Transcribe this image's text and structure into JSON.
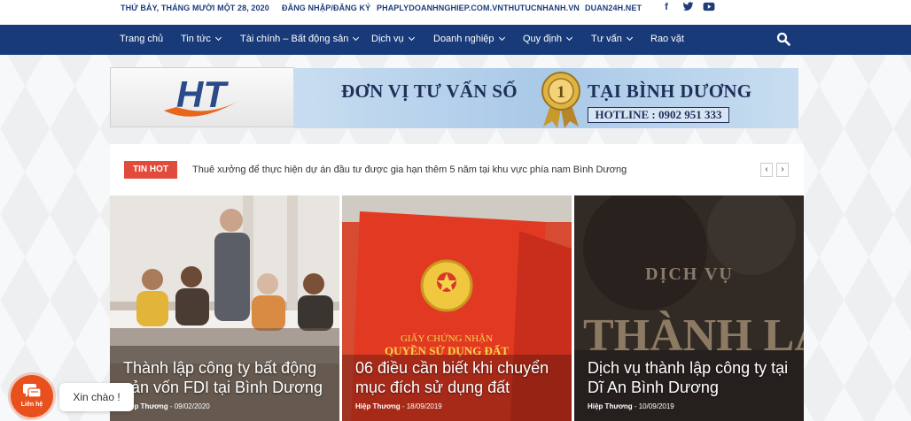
{
  "topbar": {
    "date": "THỨ BẢY, THÁNG MƯỜI MỘT 28, 2020",
    "login": "ĐĂNG NHẬP/ĐĂNG KÝ",
    "links": [
      "PHAPLYDOANHNGHIEP.COM.VN",
      "THUTUCNHANH.VN",
      "DUAN24H.NET"
    ],
    "social": [
      "facebook-icon",
      "twitter-icon",
      "youtube-icon"
    ]
  },
  "nav": {
    "items": [
      {
        "label": "Trang chủ",
        "dropdown": false
      },
      {
        "label": "Tin tức",
        "dropdown": true
      },
      {
        "label": "Tài chính – Bất động sản",
        "dropdown": true
      },
      {
        "label": "Dịch vụ",
        "dropdown": true
      },
      {
        "label": "Doanh nghiệp",
        "dropdown": true
      },
      {
        "label": "Quy định",
        "dropdown": true
      },
      {
        "label": "Tư vấn",
        "dropdown": true
      },
      {
        "label": "Rao vặt",
        "dropdown": false
      }
    ],
    "search_icon": "search-icon"
  },
  "banner": {
    "logo_text": "HT",
    "slogan_left": "ĐƠN VỊ TƯ VẤN SỐ",
    "medal_number": "1",
    "slogan_right": "TẠI BÌNH DƯƠNG",
    "hotline": "HOTLINE : 0902 951 333"
  },
  "hot": {
    "label": "TIN HOT",
    "text": "Thuê xưởng để thực hiện dự án đầu tư được gia hạn thêm 5 năm tại khu vực phía nam Bình Dương"
  },
  "cards": [
    {
      "title": "Thành lập công ty bất động sản vốn FDI tại Bình Dương",
      "author": "Hiệp Thương",
      "date": "09/02/2020"
    },
    {
      "title": "06 điều cần biết khi chuyển mục đích sử dụng đất",
      "author": "Hiệp Thương",
      "date": "18/09/2019",
      "image_text_1": "GIẤY CHỨNG NHẬN",
      "image_text_2": "QUYỀN SỬ DỤNG ĐẤT"
    },
    {
      "title": "Dịch vụ thành lập công ty tại Dĩ An Bình Dương",
      "author": "Hiệp Thương",
      "date": "10/09/2019",
      "image_text_1": "DỊCH VỤ",
      "image_text_2": "THÀNH LẬ"
    }
  ],
  "chat": {
    "label": "Liên hệ",
    "greeting": "Xin chào !"
  },
  "colors": {
    "nav": "#183a79",
    "accent": "#e14b3b",
    "chat": "#e8501d"
  }
}
